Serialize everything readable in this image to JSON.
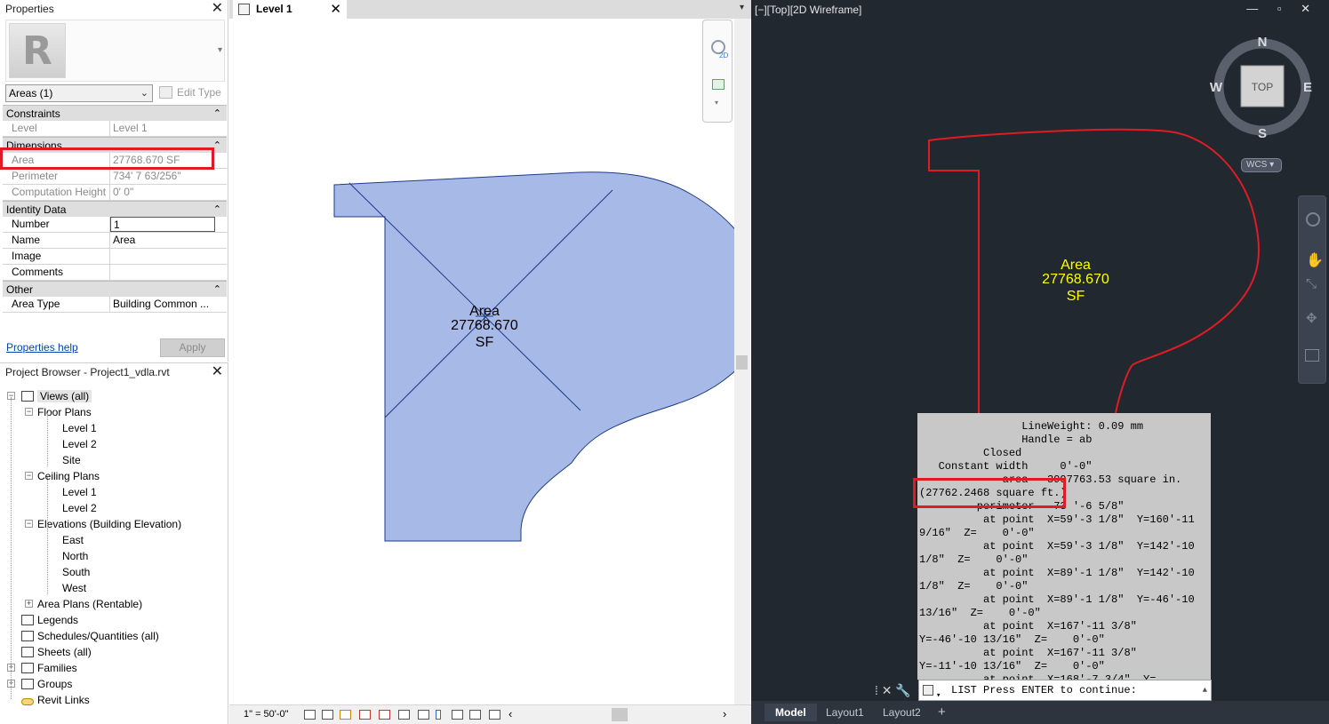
{
  "properties": {
    "title": "Properties",
    "type_selector": "Areas (1)",
    "edit_type": "Edit Type",
    "groups": [
      {
        "name": "Constraints",
        "rows": [
          {
            "key": "Level",
            "value": "Level 1",
            "readonly": true
          }
        ]
      },
      {
        "name": "Dimensions",
        "rows": [
          {
            "key": "Area",
            "value": "27768.670 SF",
            "readonly": true
          },
          {
            "key": "Perimeter",
            "value": "734'  7 63/256\"",
            "readonly": true
          },
          {
            "key": "Computation Height",
            "value": "0'  0\"",
            "readonly": true
          }
        ]
      },
      {
        "name": "Identity Data",
        "rows": [
          {
            "key": "Number",
            "value": "1",
            "readonly": false
          },
          {
            "key": "Name",
            "value": "Area",
            "readonly": false
          },
          {
            "key": "Image",
            "value": "",
            "readonly": false
          },
          {
            "key": "Comments",
            "value": "",
            "readonly": false
          }
        ]
      },
      {
        "name": "Other",
        "rows": [
          {
            "key": "Area Type",
            "value": "Building Common ...",
            "readonly": false
          }
        ]
      }
    ],
    "help_link": "Properties help",
    "apply_label": "Apply"
  },
  "browser": {
    "title": "Project Browser - Project1_vdla.rvt",
    "nodes": [
      {
        "label": "Views (all)",
        "depth": 0,
        "expander": "-",
        "icon": "views-icon",
        "selected": true
      },
      {
        "label": "Floor Plans",
        "depth": 1,
        "expander": "-"
      },
      {
        "label": "Level 1",
        "depth": 2
      },
      {
        "label": "Level 2",
        "depth": 2
      },
      {
        "label": "Site",
        "depth": 2
      },
      {
        "label": "Ceiling Plans",
        "depth": 1,
        "expander": "-"
      },
      {
        "label": "Level 1",
        "depth": 2
      },
      {
        "label": "Level 2",
        "depth": 2
      },
      {
        "label": "Elevations (Building Elevation)",
        "depth": 1,
        "expander": "-"
      },
      {
        "label": "East",
        "depth": 2
      },
      {
        "label": "North",
        "depth": 2
      },
      {
        "label": "South",
        "depth": 2
      },
      {
        "label": "West",
        "depth": 2
      },
      {
        "label": "Area Plans (Rentable)",
        "depth": 1,
        "expander": "+"
      },
      {
        "label": "Legends",
        "depth": 0,
        "icon": "legends-icon"
      },
      {
        "label": "Schedules/Quantities (all)",
        "depth": 0,
        "icon": "schedules-icon"
      },
      {
        "label": "Sheets (all)",
        "depth": 0,
        "icon": "sheets-icon"
      },
      {
        "label": "Families",
        "depth": 0,
        "expander": "+",
        "icon": "families-icon"
      },
      {
        "label": "Groups",
        "depth": 0,
        "expander": "+",
        "icon": "groups-icon"
      },
      {
        "label": "Revit Links",
        "depth": 0,
        "icon": "revit-links-icon"
      }
    ]
  },
  "revit_view": {
    "tab_label": "Level 1",
    "area_tag": [
      "Area",
      "27768.670",
      "SF"
    ],
    "scale": "1\" = 50'-0\"",
    "fill_color": "#a7b9e6"
  },
  "acad": {
    "viewport_label": "[−][Top][2D Wireframe]",
    "viewcube": {
      "top": "TOP",
      "n": "N",
      "s": "S",
      "e": "E",
      "w": "W"
    },
    "wcs": "WCS",
    "area_text": [
      "Area",
      "27768.670",
      "SF"
    ],
    "area_text_color": "#ffff00",
    "polyline_color": "#e01b24",
    "list_lines": [
      "                LineWeight: 0.09 mm",
      "                Handle = ab",
      "          Closed",
      "   Constant width     0'-0\"",
      "             area   3997763.53 square in.",
      "(27762.2468 square ft.)",
      "         perimeter   73 '-6 5/8\"",
      "          at point  X=59'-3 1/8\"  Y=160'-11",
      "9/16\"  Z=    0'-0\"",
      "          at point  X=59'-3 1/8\"  Y=142'-10",
      "1/8\"  Z=    0'-0\"",
      "          at point  X=89'-1 1/8\"  Y=142'-10",
      "1/8\"  Z=    0'-0\"",
      "          at point  X=89'-1 1/8\"  Y=-46'-10",
      "13/16\"  Z=    0'-0\"",
      "          at point  X=167'-11 3/8\"",
      "Y=-46'-10 13/16\"  Z=    0'-0\"",
      "          at point  X=167'-11 3/8\"",
      "Y=-11'-10 13/16\"  Z=    0'-0\"",
      "          at point  X=168'-7 3/4\"  Y="
    ],
    "command_line": "LIST Press ENTER to continue:",
    "layout_tabs": [
      "Model",
      "Layout1",
      "Layout2"
    ],
    "active_tab": "Model"
  }
}
